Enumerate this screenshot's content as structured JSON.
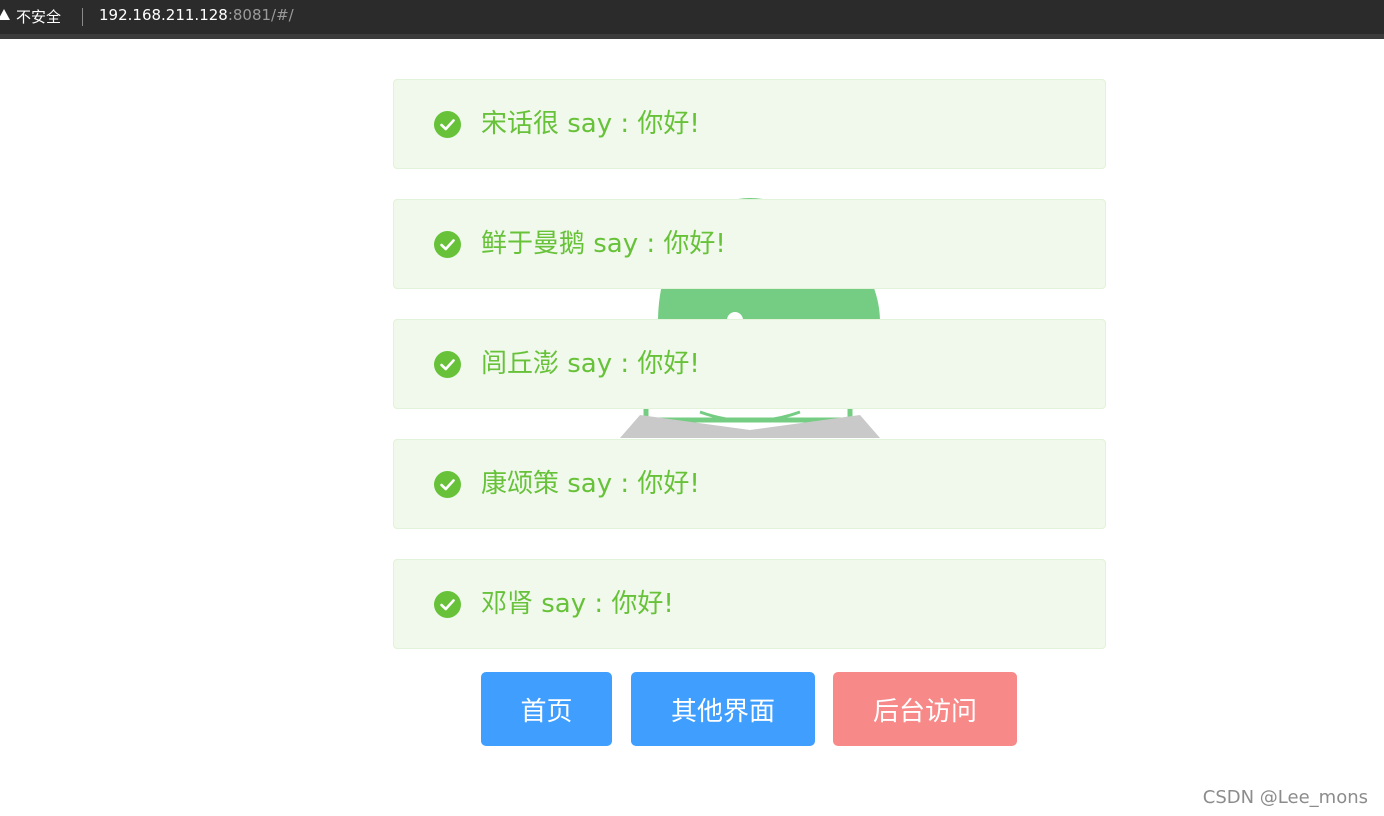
{
  "browser": {
    "security_label": "不安全",
    "url_host": "192.168.211.128",
    "url_rest": ":8081/#/"
  },
  "messages": [
    {
      "text": "宋话很 say : 你好!",
      "status": "success"
    },
    {
      "text": "鲜于曼鹅 say : 你好!",
      "status": "success"
    },
    {
      "text": "闾丘澎 say : 你好!",
      "status": "success"
    },
    {
      "text": "康颂策 say : 你好!",
      "status": "success"
    },
    {
      "text": "邓肾 say : 你好!",
      "status": "success"
    }
  ],
  "buttons": {
    "home": "首页",
    "other": "其他界面",
    "admin": "后台访问"
  },
  "watermark": "CSDN @Lee_mons",
  "colors": {
    "success_text": "#67c23a",
    "success_bg": "#f0f9eb",
    "primary": "#409eff",
    "danger_light": "#f78989"
  },
  "icons": {
    "message": "check-circle-icon",
    "browser": "warning-triangle-icon",
    "background": "vue-logo"
  }
}
